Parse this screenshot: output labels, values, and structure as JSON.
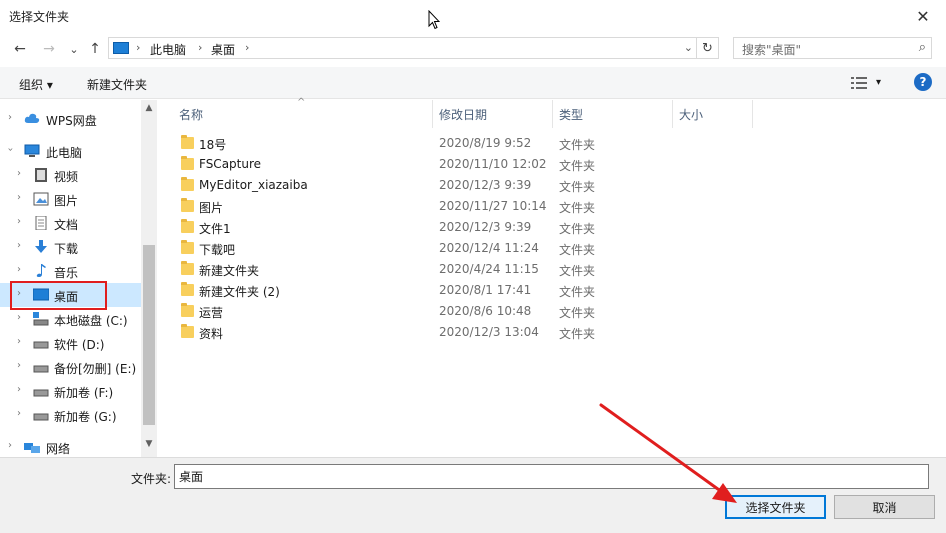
{
  "window": {
    "title": "选择文件夹",
    "close_glyph": "✕"
  },
  "nav": {
    "back_glyph": "←",
    "forward_glyph": "→",
    "recent_glyph": "⌄",
    "up_glyph": "↑"
  },
  "address": {
    "crumbs": [
      "此电脑",
      "桌面"
    ],
    "sep_glyph": "›",
    "dropdown_glyph": "⌄",
    "refresh_glyph": "↻"
  },
  "search": {
    "placeholder": "搜索\"桌面\"",
    "icon_glyph": "⌕"
  },
  "toolbar": {
    "organize_label": "组织 ▾",
    "new_folder_label": "新建文件夹",
    "view_dropdown_glyph": "▾",
    "help_glyph": "?"
  },
  "sidebar": {
    "items": [
      {
        "label": "WPS网盘",
        "icon": "cloud-icon",
        "level": 0,
        "expanded": false
      },
      {
        "label": "此电脑",
        "icon": "pc-icon",
        "level": 0,
        "expanded": true
      },
      {
        "label": "视频",
        "icon": "video-icon",
        "level": 1,
        "expanded": false
      },
      {
        "label": "图片",
        "icon": "picture-icon",
        "level": 1,
        "expanded": false
      },
      {
        "label": "文档",
        "icon": "document-icon",
        "level": 1,
        "expanded": false
      },
      {
        "label": "下载",
        "icon": "download-icon",
        "level": 1,
        "expanded": false
      },
      {
        "label": "音乐",
        "icon": "music-icon",
        "level": 1,
        "expanded": false
      },
      {
        "label": "桌面",
        "icon": "desktop-icon",
        "level": 1,
        "expanded": false,
        "selected": true
      },
      {
        "label": "本地磁盘 (C:)",
        "icon": "system-drive-icon",
        "level": 1,
        "expanded": false
      },
      {
        "label": "软件 (D:)",
        "icon": "drive-icon",
        "level": 1,
        "expanded": false
      },
      {
        "label": "备份[勿删] (E:)",
        "icon": "drive-icon",
        "level": 1,
        "expanded": false
      },
      {
        "label": "新加卷 (F:)",
        "icon": "drive-icon",
        "level": 1,
        "expanded": false
      },
      {
        "label": "新加卷 (G:)",
        "icon": "drive-icon",
        "level": 1,
        "expanded": false
      },
      {
        "label": "网络",
        "icon": "network-icon",
        "level": 0,
        "expanded": false
      }
    ],
    "scroll_up_glyph": "▲",
    "scroll_down_glyph": "▼"
  },
  "columns": {
    "name": "名称",
    "date": "修改日期",
    "type": "类型",
    "size": "大小",
    "sort_caret": "^"
  },
  "files": [
    {
      "name": "18号",
      "date": "2020/8/19 9:52",
      "type": "文件夹"
    },
    {
      "name": "FSCapture",
      "date": "2020/11/10 12:02",
      "type": "文件夹"
    },
    {
      "name": "MyEditor_xiazaiba",
      "date": "2020/12/3 9:39",
      "type": "文件夹"
    },
    {
      "name": "图片",
      "date": "2020/11/27 10:14",
      "type": "文件夹"
    },
    {
      "name": "文件1",
      "date": "2020/12/3 9:39",
      "type": "文件夹"
    },
    {
      "name": "下载吧",
      "date": "2020/12/4 11:24",
      "type": "文件夹"
    },
    {
      "name": "新建文件夹",
      "date": "2020/4/24 11:15",
      "type": "文件夹"
    },
    {
      "name": "新建文件夹 (2)",
      "date": "2020/8/1 17:41",
      "type": "文件夹"
    },
    {
      "name": "运营",
      "date": "2020/8/6 10:48",
      "type": "文件夹"
    },
    {
      "name": "资料",
      "date": "2020/12/3 13:04",
      "type": "文件夹"
    }
  ],
  "footer": {
    "folder_label": "文件夹:",
    "folder_value": "桌面",
    "select_button": "选择文件夹",
    "cancel_button": "取消"
  },
  "colors": {
    "accent": "#0078d7",
    "selection": "#cce8ff",
    "highlight_box": "#e01e1e",
    "arrow": "#e01e1e"
  }
}
